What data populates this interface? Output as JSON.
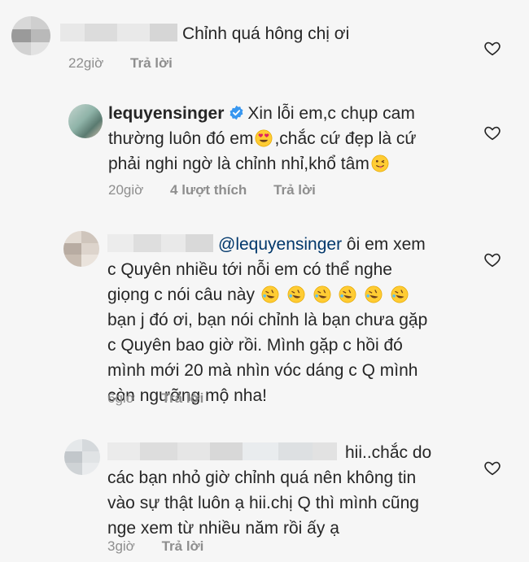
{
  "comments": [
    {
      "text_lines": [
        "Chỉnh quá hông chị ơi"
      ],
      "time": "22giờ",
      "reply": "Trả lời"
    },
    {
      "username": "lequyensinger",
      "text_lines": [
        "Xin lỗi em,c chụp cam",
        "thường luôn đó em",
        ",chắc cứ đẹp là cứ",
        "phải nghi ngờ là chỉnh nhỉ,khổ tâm"
      ],
      "time": "20giờ",
      "likes": "4 lượt thích",
      "reply": "Trả lời"
    },
    {
      "mention": "@lequyensinger",
      "text_lines": [
        "ôi em xem",
        "c Quyên nhiều tới nỗi em có thể nghe",
        "giọng c nói câu này",
        "bạn j đó ơi, bạn nói chỉnh là bạn chưa gặp",
        "c Quyên bao giờ rồi. Mình gặp c hồi đó",
        "mình mới 20 mà nhìn vóc dáng c Q mình",
        "còn ngưỡng mộ nha!"
      ],
      "time": "6giờ",
      "reply": "Trả lời"
    },
    {
      "text_lines": [
        "hii..chắc do",
        "các bạn nhỏ giờ chỉnh quá nên không tin",
        "vào sự thật luôn ạ hii.chị Q thì mình cũng",
        "nge xem từ nhiều năm rồi ấy ạ"
      ],
      "time": "3giờ",
      "reply": "Trả lời"
    }
  ],
  "icons": {
    "like": "heart-outline-icon",
    "verified": "verified-badge-icon",
    "emoji_heart_eyes": "heart-eyes-emoji",
    "emoji_wink_tongue": "winking-tongue-emoji",
    "emoji_rofl": "rofl-emoji"
  },
  "colors": {
    "text": "#262626",
    "meta": "#8e8e8e",
    "mention": "#00376b",
    "verified": "#3897f0"
  }
}
